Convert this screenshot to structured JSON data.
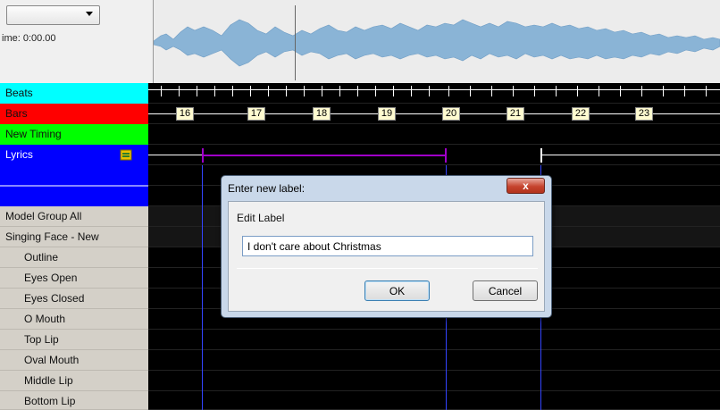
{
  "header": {
    "dropdown_value": "",
    "time_text": "ime: 0:00.00"
  },
  "timing_rows": {
    "beats": "Beats",
    "bars": "Bars",
    "new_timing": "New Timing",
    "lyrics": "Lyrics"
  },
  "bar_numbers": [
    "16",
    "17",
    "18",
    "19",
    "20",
    "21",
    "22",
    "23"
  ],
  "models": {
    "group": "Model Group All",
    "face": "Singing Face - New",
    "items": [
      "Outline",
      "Eyes Open",
      "Eyes Closed",
      "O Mouth",
      "Top Lip",
      "Oval Mouth",
      "Middle Lip",
      "Bottom Lip"
    ]
  },
  "dialog": {
    "title": "Enter new label:",
    "close": "x",
    "prompt": "Edit Label",
    "input_value": "I don't care about Christmas",
    "ok": "OK",
    "cancel": "Cancel"
  },
  "colors": {
    "beats_row": "#00ffff",
    "bars_row": "#ff0000",
    "new_timing_row": "#00ff00",
    "lyrics_row": "#0000ff",
    "waveform": "#8ab4d6",
    "lyric_phrase": "#a000c8"
  },
  "icons": {
    "lyrics_row_icon": "lyrics-edit-icon"
  }
}
